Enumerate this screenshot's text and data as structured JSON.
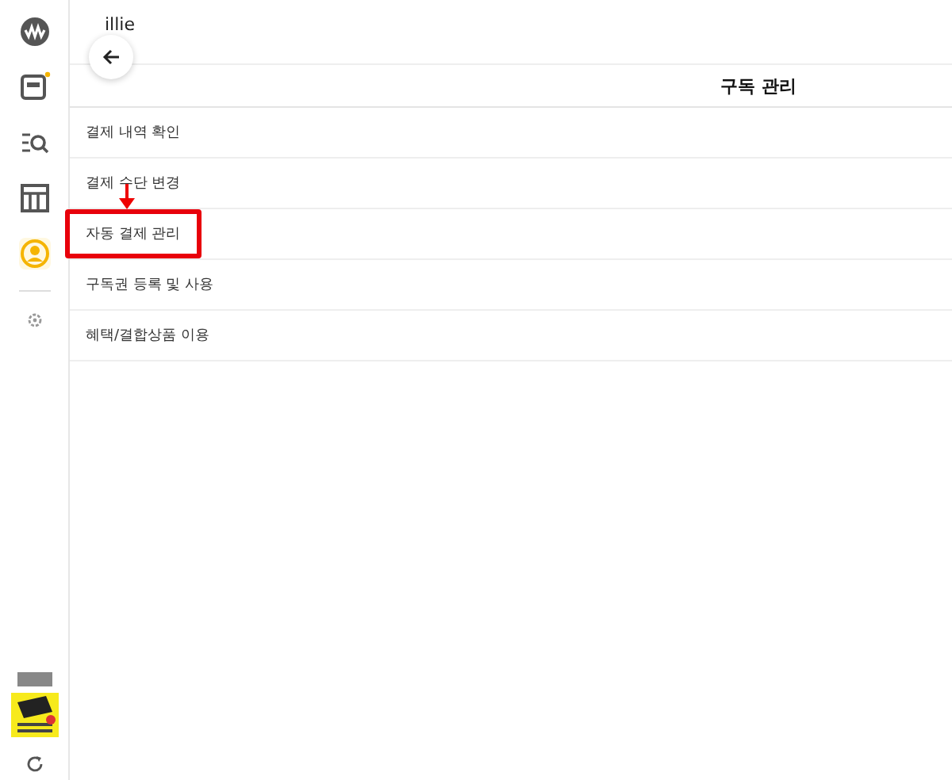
{
  "header": {
    "app_name": "illie"
  },
  "title_bar": {
    "title": "구독 관리"
  },
  "sidebar": {
    "items": [
      {
        "kind": "logo",
        "selected": false
      },
      {
        "kind": "screen",
        "selected": false,
        "badge": true
      },
      {
        "kind": "search",
        "selected": false
      },
      {
        "kind": "store",
        "selected": false
      },
      {
        "kind": "profile",
        "selected": true
      },
      {
        "kind": "settings",
        "selected": false
      }
    ]
  },
  "menu": [
    {
      "label": "결제 내역 확인",
      "highlighted": false
    },
    {
      "label": "결제 수단 변경",
      "highlighted": false
    },
    {
      "label": "자동 결제 관리",
      "highlighted": true
    },
    {
      "label": "구독권 등록 및 사용",
      "highlighted": false
    },
    {
      "label": "혜택/결합상품 이용",
      "highlighted": false
    }
  ]
}
